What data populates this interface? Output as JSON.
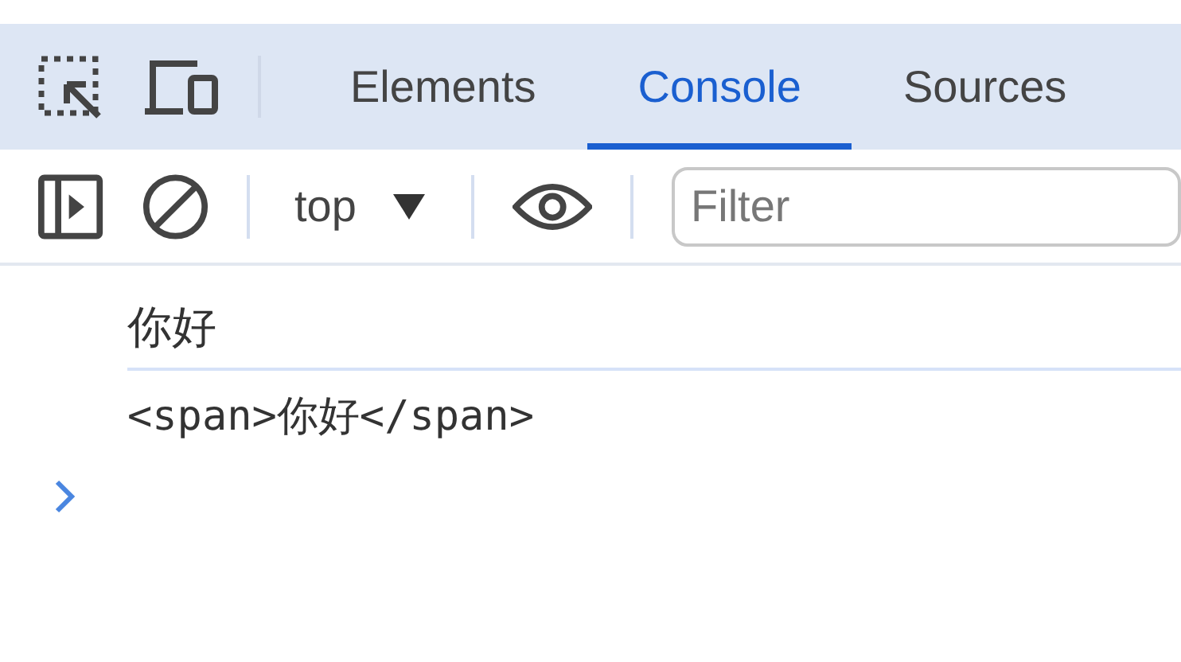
{
  "tabs": [
    {
      "label": "Elements",
      "selected": false
    },
    {
      "label": "Console",
      "selected": true
    },
    {
      "label": "Sources",
      "selected": false
    }
  ],
  "console_toolbar": {
    "context": "top",
    "filter_placeholder": "Filter"
  },
  "messages": [
    {
      "kind": "text",
      "text": "你好"
    },
    {
      "kind": "markup",
      "text": "<span>你好</span>"
    }
  ]
}
